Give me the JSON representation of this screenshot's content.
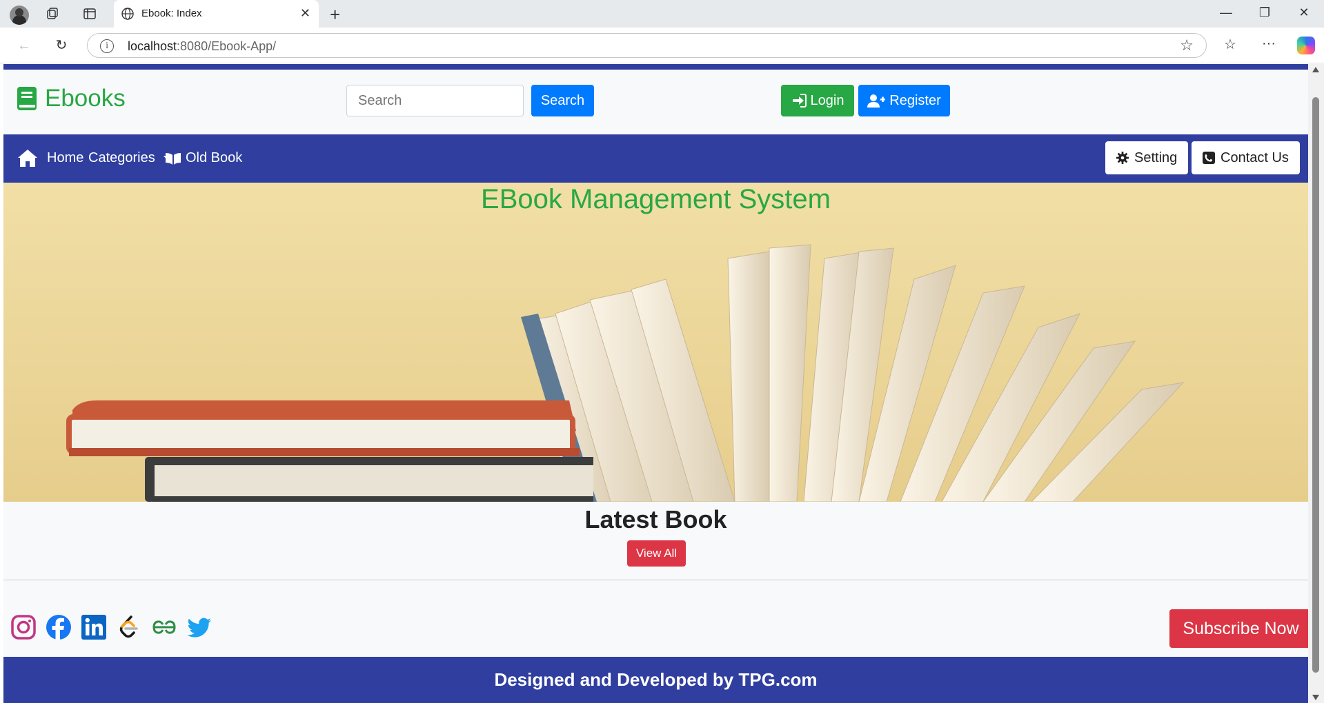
{
  "browser": {
    "tab_title": "Ebook: Index",
    "url_host": "localhost",
    "url_rest": ":8080/Ebook-App/"
  },
  "header": {
    "brand": "Ebooks",
    "search_placeholder": "Search",
    "search_button": "Search",
    "login_button": "Login",
    "register_button": "Register"
  },
  "navbar": {
    "home": "Home",
    "categories": "Categories",
    "old_book": "Old Book",
    "setting": "Setting",
    "contact": "Contact Us"
  },
  "hero": {
    "title": "EBook Management System"
  },
  "latest": {
    "title": "Latest Book",
    "view_all": "View All"
  },
  "social": [
    "instagram-icon",
    "facebook-icon",
    "linkedin-icon",
    "leetcode-icon",
    "geeksforgeeks-icon",
    "twitter-icon"
  ],
  "subscribe_button": "Subscribe Now",
  "footer": {
    "text": "Designed and Developed by TPG.com"
  },
  "colors": {
    "primary_nav": "#303f9f",
    "brand_green": "#28a745",
    "blue": "#007bff",
    "red": "#dc3545"
  }
}
